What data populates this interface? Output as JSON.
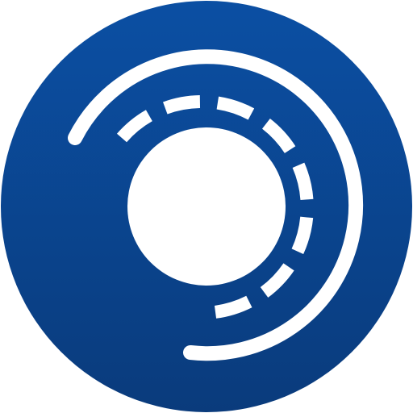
{
  "icon": {
    "name": "circular-road-icon",
    "colors": {
      "background": "#ffffff",
      "disc_top": "#0b4fa3",
      "disc_bottom": "#0a3b7c",
      "foreground": "#ffffff"
    }
  }
}
